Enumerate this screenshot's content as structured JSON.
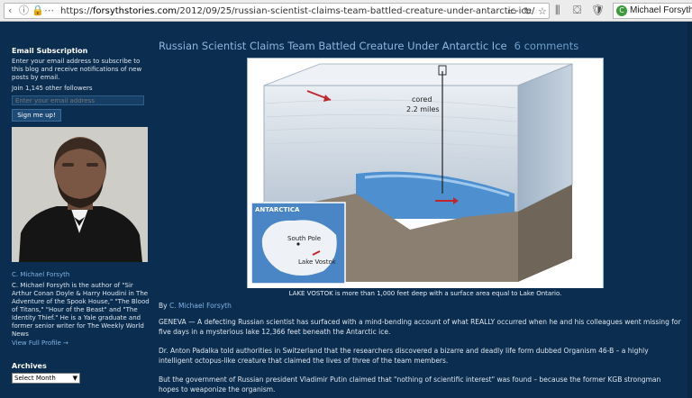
{
  "browser": {
    "url_protocol": "https://",
    "url_host": "forsythstories.com",
    "url_path": "/2012/09/25/russian-scientist-claims-team-battled-creature-under-antarctic-ice/",
    "tab_title": "Michael Forsyth W",
    "tab_badge": "C"
  },
  "sidebar": {
    "email_heading": "Email Subscription",
    "email_desc": "Enter your email address to subscribe to this blog and receive notifications of new posts by email.",
    "followers": "Join 1,145 other followers",
    "email_placeholder": "Enter your email address",
    "signup_label": "Sign me up!",
    "author_name": "C. Michael Forsyth",
    "author_bio": "C. Michael Forsyth is the author of \"Sir Arthur Conan Doyle & Harry Houdini in The Adventure of the Spook House,\" \"The Blood of Titans,\" \"Hour of the Beast\" and \"The Identity Thief.\" He is a Yale graduate and former senior writer for The Weekly World News",
    "view_profile": "View Full Profile →",
    "archives_heading": "Archives",
    "archives_select": "Select Month"
  },
  "post": {
    "title": "Russian Scientist Claims Team Battled Creature Under Antarctic Ice",
    "comments": "6 comments",
    "figure": {
      "label_cored": "cored",
      "label_depth": "2.2 miles",
      "inset_region": "ANTARCTICA",
      "inset_pole": "South Pole",
      "inset_lake": "Lake Vostok"
    },
    "caption": "LAKE VOSTOK is more than 1,000 feet deep with a surface area equal to Lake Ontario.",
    "byline_prefix": "By",
    "byline_author": "C. Michael Forsyth",
    "paragraphs": [
      "GENEVA — A defecting Russian scientist has surfaced with a mind-bending account of what REALLY occurred when he and his colleagues went missing for five days in a mysterious lake 12,366 feet beneath the Antarctic ice.",
      "Dr. Anton Padalka told authorities in Switzerland that the researchers discovered a bizarre and deadly life form dubbed Organism 46-B – a highly intelligent octopus-like creature that claimed the lives of three of the team members.",
      "But the government of Russian president Vladimir Putin claimed that \"nothing of scientific interest\" was found – because the former KGB strongman hopes to weaponize the organism."
    ]
  }
}
